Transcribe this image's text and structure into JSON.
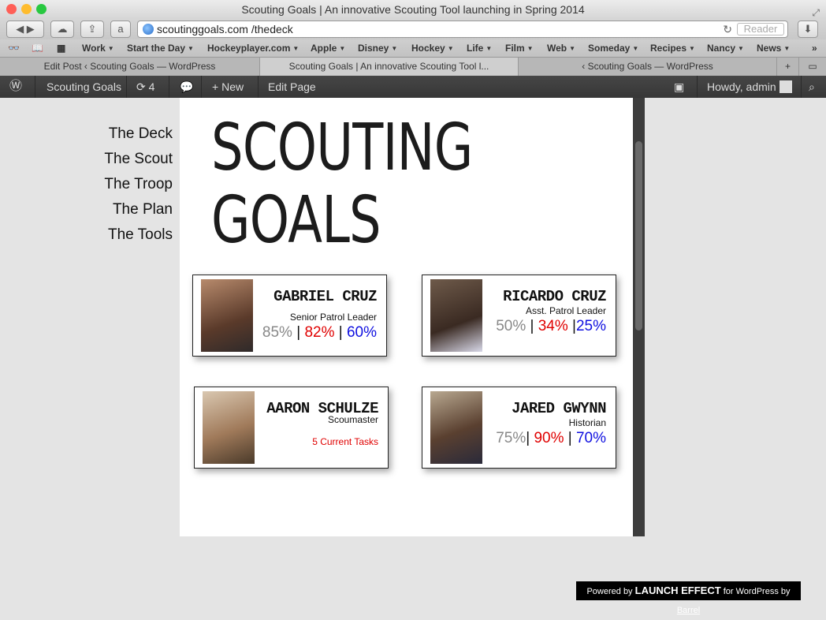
{
  "window": {
    "title": "Scouting Goals | An innovative Scouting Tool launching in Spring 2014"
  },
  "toolbar": {
    "url": "scoutinggoals.com /thedeck",
    "reader_label": "Reader"
  },
  "bookmarks": [
    {
      "label": "Work",
      "arrow": "▼"
    },
    {
      "label": "Start the Day",
      "arrow": "▼"
    },
    {
      "label": "Hockeyplayer.com",
      "arrow": "▼"
    },
    {
      "label": "Apple",
      "arrow": "▼"
    },
    {
      "label": "Disney",
      "arrow": "▼"
    },
    {
      "label": "Hockey",
      "arrow": "▼"
    },
    {
      "label": "Life",
      "arrow": "▼"
    },
    {
      "label": "Film",
      "arrow": "▼"
    },
    {
      "label": "Web",
      "arrow": "▼"
    },
    {
      "label": "Someday",
      "arrow": "▼"
    },
    {
      "label": "Recipes",
      "arrow": "▼"
    },
    {
      "label": "Nancy",
      "arrow": "▼"
    },
    {
      "label": "News",
      "arrow": "▼"
    }
  ],
  "tabs": [
    {
      "label": "Edit Post ‹ Scouting Goals — WordPress"
    },
    {
      "label": "Scouting Goals | An innovative Scouting Tool l..."
    },
    {
      "label": "‹ Scouting Goals — WordPress"
    }
  ],
  "adminbar": {
    "site": "Scouting Goals",
    "updates": "4",
    "new": "New",
    "edit": "Edit Page",
    "howdy": "Howdy, admin"
  },
  "nav": [
    "The Deck",
    "The Scout",
    "The Troop",
    "The Plan",
    "The Tools"
  ],
  "page_title": {
    "line1": "SCOUTING",
    "line2": "GOALS"
  },
  "cards": [
    {
      "name": "GABRIEL CRUZ",
      "role": "Senior Patrol Leader",
      "s1": "85%",
      "sep1": " | ",
      "s2": "82%",
      "sep2": " | ",
      "s3": "60%"
    },
    {
      "name": "RICARDO CRUZ",
      "role": "Asst. Patrol Leader",
      "s1": "50%",
      "sep1": " | ",
      "s2": "34%",
      "sep2": " |",
      "s3": "25%"
    },
    {
      "name": "AARON SCHULZE",
      "role": "Scoumaster",
      "tasks": "5 Current Tasks"
    },
    {
      "name": "JARED GWYNN",
      "role": "Historian",
      "s1": "75%",
      "sep1": "| ",
      "s2": "90%",
      "sep2": " | ",
      "s3": "70%"
    }
  ],
  "footer": {
    "powered": "Powered by",
    "brand": "LAUNCH EFFECT",
    "for": "for WordPress by",
    "by": "Barrel"
  },
  "colors": {
    "red": "#e00000",
    "blue": "#1010e0",
    "gray": "#888888",
    "adminbar": "#373737"
  }
}
